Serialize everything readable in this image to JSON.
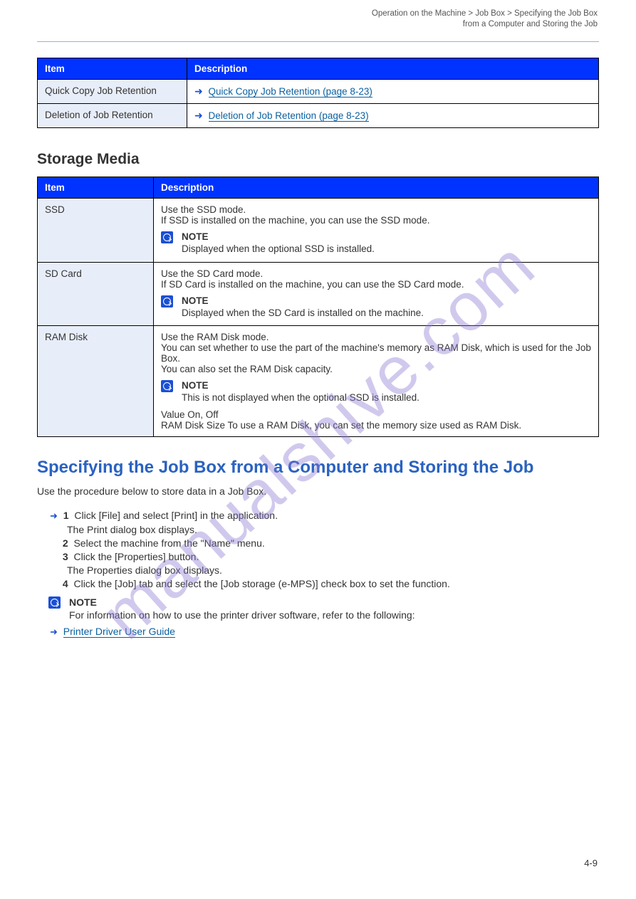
{
  "topic_path": "Operation on the Machine > Job Box > Specifying the Job Box\nfrom a Computer and Storing the Job",
  "table1": {
    "headers": [
      "Item",
      "Description"
    ],
    "rows": [
      {
        "item": "Quick Copy Job Retention",
        "desc": "",
        "ref_text": "Quick Copy Job Retention (page 8-23)"
      },
      {
        "item": "Deletion of Job Retention",
        "desc": "",
        "ref_text": "Deletion of Job Retention (page 8-23)"
      }
    ]
  },
  "section_title": "Storage Media",
  "table2": {
    "headers": [
      "Item",
      "Description"
    ],
    "rows": [
      {
        "item": "SSD",
        "desc1": "Use the SSD mode.",
        "desc2": "If SSD is installed on the machine, you can use the SSD mode.",
        "note": "Displayed when the optional SSD is installed."
      },
      {
        "item": "SD Card",
        "desc1": "Use the SD Card mode.",
        "desc2": "If SD Card is installed on the machine, you can use the SD Card mode.",
        "note": "Displayed when the SD Card is installed on the machine."
      },
      {
        "item": "RAM Disk",
        "desc1": "Use the RAM Disk mode.",
        "desc2a": "You can set whether to use the part of the machine's memory as RAM Disk, which is used for the Job Box.",
        "desc2b": "You can also set the RAM Disk capacity.",
        "note": "This is not displayed when the optional SSD is installed.",
        "desc3": "Value On, Off",
        "desc4": "RAM Disk Size To use a RAM Disk, you can set the memory size used as RAM Disk."
      }
    ]
  },
  "h2": "Specifying the Job Box from a Computer and Storing the Job",
  "p1": "Use the procedure below to store data in a Job Box.",
  "step1_n": "1",
  "step1_t": "Click [File] and select [Print] in the application.",
  "step1_b": "The Print dialog box displays.",
  "step2_n": "2",
  "step2_t": "Select the machine from the \"Name\" menu.",
  "step3_n": "3",
  "step3_t": "Click the [Properties] button.",
  "step3_b": "The Properties dialog box displays.",
  "step4_n": "4",
  "step4_t": "Click the [Job] tab and select the [Job storage (e-MPS)] check box to set the function.",
  "ref_intro": "For information on how to use the printer driver software, refer to the following:",
  "ref_link": "Printer Driver User Guide",
  "page_number": "4-9"
}
